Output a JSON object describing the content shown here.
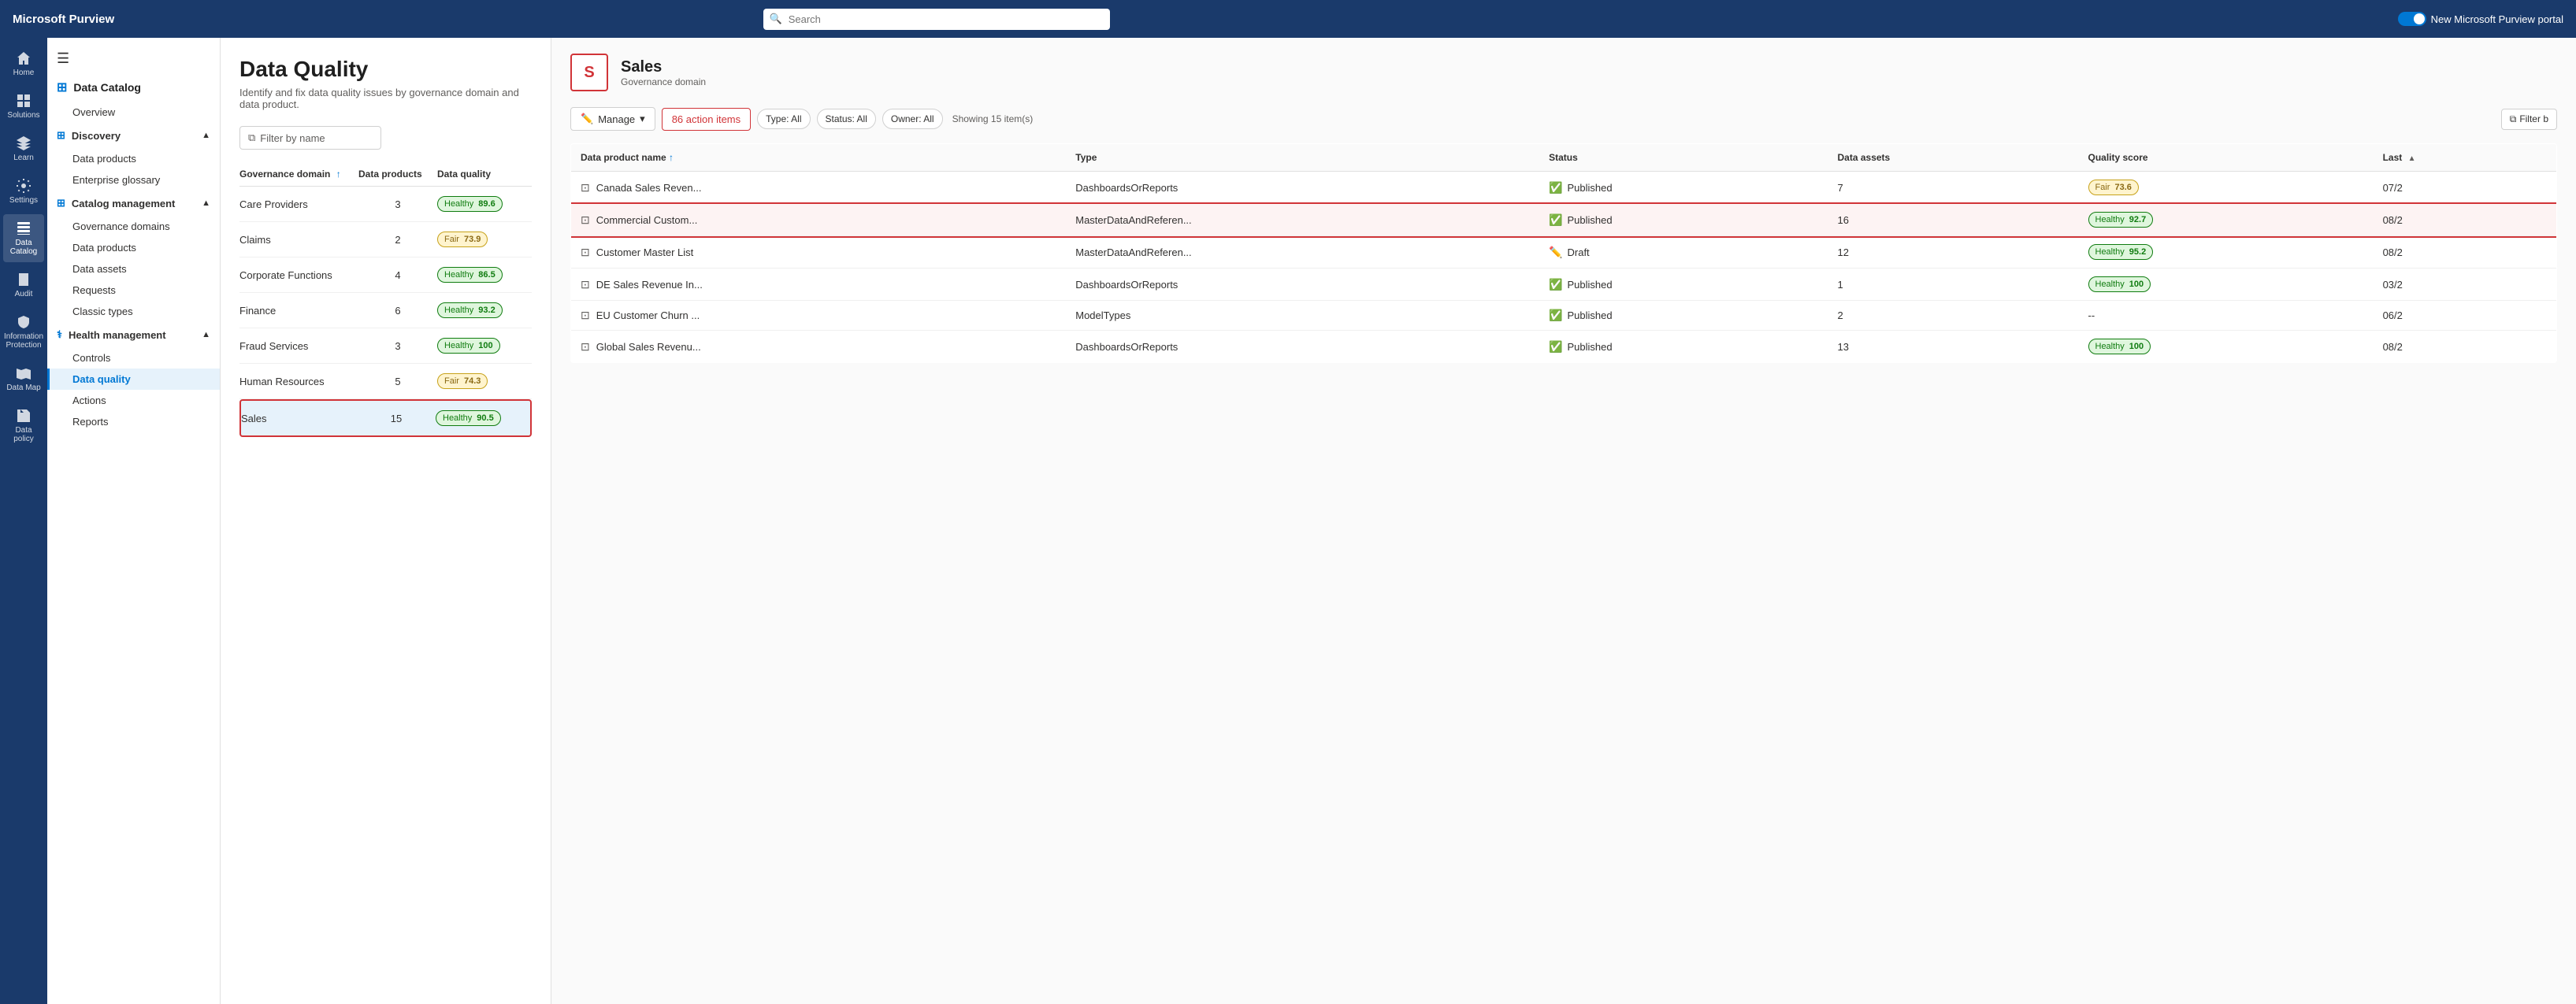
{
  "app": {
    "brand": "Microsoft Purview",
    "search_placeholder": "Search",
    "toggle_label": "New Microsoft Purview portal"
  },
  "icon_sidebar": {
    "items": [
      {
        "id": "home",
        "label": "Home",
        "icon": "home"
      },
      {
        "id": "solutions",
        "label": "Solutions",
        "icon": "grid"
      },
      {
        "id": "learn",
        "label": "Learn",
        "icon": "book"
      },
      {
        "id": "settings",
        "label": "Settings",
        "icon": "gear"
      },
      {
        "id": "data-catalog",
        "label": "Data Catalog",
        "icon": "catalog",
        "active": true
      },
      {
        "id": "audit",
        "label": "Audit",
        "icon": "audit"
      },
      {
        "id": "info-protection",
        "label": "Information Protection",
        "icon": "shield"
      },
      {
        "id": "data-map",
        "label": "Data Map",
        "icon": "map"
      },
      {
        "id": "data-policy",
        "label": "Data policy",
        "icon": "policy"
      }
    ]
  },
  "nav_sidebar": {
    "section_title": "Data Catalog",
    "overview_label": "Overview",
    "groups": [
      {
        "id": "discovery",
        "label": "Discovery",
        "expanded": true,
        "items": [
          {
            "id": "data-products",
            "label": "Data products"
          },
          {
            "id": "enterprise-glossary",
            "label": "Enterprise glossary"
          }
        ]
      },
      {
        "id": "catalog-management",
        "label": "Catalog management",
        "expanded": true,
        "items": [
          {
            "id": "governance-domains",
            "label": "Governance domains"
          },
          {
            "id": "data-products-mgmt",
            "label": "Data products"
          },
          {
            "id": "data-assets",
            "label": "Data assets"
          },
          {
            "id": "requests",
            "label": "Requests"
          },
          {
            "id": "classic-types",
            "label": "Classic types"
          }
        ]
      },
      {
        "id": "health-management",
        "label": "Health management",
        "expanded": true,
        "items": [
          {
            "id": "controls",
            "label": "Controls"
          },
          {
            "id": "data-quality",
            "label": "Data quality",
            "active": true
          },
          {
            "id": "actions",
            "label": "Actions"
          },
          {
            "id": "reports",
            "label": "Reports"
          }
        ]
      }
    ]
  },
  "page": {
    "title": "Data Quality",
    "subtitle": "Identify and fix data quality issues by governance domain and data product.",
    "filter_placeholder": "Filter by name"
  },
  "governance_table": {
    "headers": {
      "domain": "Governance domain",
      "products": "Data products",
      "quality": "Data quality"
    },
    "rows": [
      {
        "id": "care-providers",
        "domain": "Care Providers",
        "products": "3",
        "quality_label": "Healthy",
        "quality_score": "89.6",
        "type": "healthy"
      },
      {
        "id": "claims",
        "domain": "Claims",
        "products": "2",
        "quality_label": "Fair",
        "quality_score": "73.9",
        "type": "fair"
      },
      {
        "id": "corporate-functions",
        "domain": "Corporate Functions",
        "products": "4",
        "quality_label": "Healthy",
        "quality_score": "86.5",
        "type": "healthy"
      },
      {
        "id": "finance",
        "domain": "Finance",
        "products": "6",
        "quality_label": "Healthy",
        "quality_score": "93.2",
        "type": "healthy"
      },
      {
        "id": "fraud-services",
        "domain": "Fraud Services",
        "products": "3",
        "quality_label": "Healthy",
        "quality_score": "100",
        "type": "healthy"
      },
      {
        "id": "human-resources",
        "domain": "Human Resources",
        "products": "5",
        "quality_label": "Fair",
        "quality_score": "74.3",
        "type": "fair"
      },
      {
        "id": "sales",
        "domain": "Sales",
        "products": "15",
        "quality_label": "Healthy",
        "quality_score": "90.5",
        "type": "healthy",
        "selected": true,
        "highlighted": true
      }
    ]
  },
  "domain_detail": {
    "avatar_letter": "S",
    "name": "Sales",
    "type": "Governance domain",
    "manage_label": "Manage",
    "action_items_label": "86 action items",
    "filters": {
      "type_label": "Type: All",
      "status_label": "Status: All",
      "owner_label": "Owner: All"
    },
    "showing_text": "Showing 15 item(s)",
    "filter_btn": "Filter b",
    "table_headers": {
      "product_name": "Data product name",
      "type": "Type",
      "status": "Status",
      "data_assets": "Data assets",
      "quality_score": "Quality score",
      "last": "Last"
    },
    "rows": [
      {
        "id": "canada-sales",
        "name": "Canada Sales Reven...",
        "type": "DashboardsOrReports",
        "status": "Published",
        "status_type": "published",
        "data_assets": "7",
        "quality_label": "Fair",
        "quality_score": "73.6",
        "quality_type": "fair",
        "last": "07/2",
        "highlighted": false
      },
      {
        "id": "commercial-custom",
        "name": "Commercial Custom...",
        "type": "MasterDataAndReferen...",
        "status": "Published",
        "status_type": "published",
        "data_assets": "16",
        "quality_label": "Healthy",
        "quality_score": "92.7",
        "quality_type": "healthy",
        "last": "08/2",
        "highlighted": true
      },
      {
        "id": "customer-master-list",
        "name": "Customer Master List",
        "type": "MasterDataAndReferen...",
        "status": "Draft",
        "status_type": "draft",
        "data_assets": "12",
        "quality_label": "Healthy",
        "quality_score": "95.2",
        "quality_type": "healthy",
        "last": "08/2",
        "highlighted": false
      },
      {
        "id": "de-sales-revenue",
        "name": "DE Sales Revenue In...",
        "type": "DashboardsOrReports",
        "status": "Published",
        "status_type": "published",
        "data_assets": "1",
        "quality_label": "Healthy",
        "quality_score": "100",
        "quality_type": "healthy",
        "last": "03/2",
        "highlighted": false
      },
      {
        "id": "eu-customer-churn",
        "name": "EU Customer Churn ...",
        "type": "ModelTypes",
        "status": "Published",
        "status_type": "published",
        "data_assets": "2",
        "quality_label": "--",
        "quality_score": "",
        "quality_type": "none",
        "last": "06/2",
        "highlighted": false
      },
      {
        "id": "global-sales-revenue",
        "name": "Global Sales Revenu...",
        "type": "DashboardsOrReports",
        "status": "Published",
        "status_type": "published",
        "data_assets": "13",
        "quality_label": "Healthy",
        "quality_score": "100",
        "quality_type": "healthy",
        "last": "08/2",
        "highlighted": false
      }
    ]
  }
}
